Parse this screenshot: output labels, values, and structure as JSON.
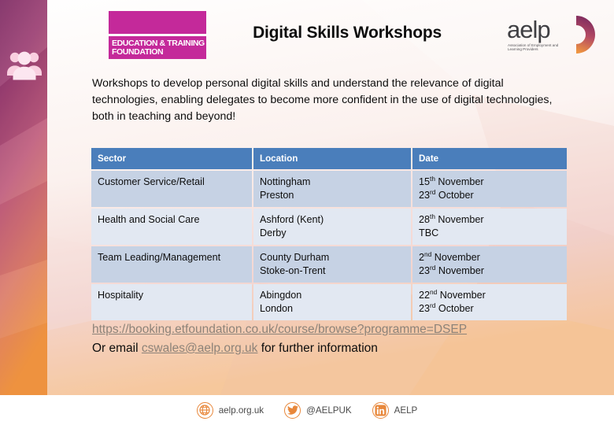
{
  "slide": {
    "title": "Digital Skills Workshops",
    "intro": "Workshops to develop personal digital skills and understand the relevance of digital technologies, enabling delegates to become more confident in the use of digital technologies, both in teaching and beyond!"
  },
  "etf_logo": {
    "line1": "EDUCATION & TRAINING",
    "line2": "FOUNDATION",
    "color": "#c4299a"
  },
  "aelp_logo": {
    "wordmark": "aelp",
    "subtitle": "Association of Employment and Learning Providers"
  },
  "table": {
    "headers": [
      "Sector",
      "Location",
      "Date"
    ],
    "header_bg": "#4a7ebb",
    "row_bg_a": "#c6d2e4",
    "row_bg_b": "#e2e8f2",
    "rows": [
      {
        "sector": "Customer Service/Retail",
        "locations": [
          "Nottingham",
          "Preston"
        ],
        "dates": [
          {
            "num": "15",
            "ord": "th",
            "rest": " November"
          },
          {
            "num": "23",
            "ord": "rd",
            "rest": " October"
          }
        ]
      },
      {
        "sector": "Health and Social Care",
        "locations": [
          "Ashford (Kent)",
          "Derby"
        ],
        "dates": [
          {
            "num": "28",
            "ord": "th",
            "rest": " November"
          },
          {
            "num": "TBC",
            "ord": "",
            "rest": ""
          }
        ]
      },
      {
        "sector": "Team Leading/Management",
        "locations": [
          "County Durham",
          "Stoke-on-Trent"
        ],
        "dates": [
          {
            "num": "2",
            "ord": "nd",
            "rest": " November"
          },
          {
            "num": "23",
            "ord": "rd",
            "rest": " November"
          }
        ]
      },
      {
        "sector": "Hospitality",
        "locations": [
          "Abingdon",
          "London"
        ],
        "dates": [
          {
            "num": "22",
            "ord": "nd",
            "rest": " November"
          },
          {
            "num": "23",
            "ord": "rd",
            "rest": " October"
          }
        ]
      }
    ]
  },
  "links": {
    "booking_url": "https://booking.etfoundation.co.uk/course/browse?programme=DSEP",
    "email_prefix": "Or email ",
    "email": "cswales@aelp.org.uk",
    "email_suffix": " for further information",
    "link_color": "#8d8379"
  },
  "footer": {
    "items": [
      {
        "icon": "globe-icon",
        "label": "aelp.org.uk"
      },
      {
        "icon": "twitter-icon",
        "label": "@AELPUK"
      },
      {
        "icon": "linkedin-icon",
        "label": "AELP"
      }
    ],
    "accent": "#e8873a"
  },
  "sidebar": {
    "icon": "people-group-icon",
    "gradient_top": "#7e2a63",
    "gradient_mid": "#c9607f",
    "gradient_bottom": "#ef9540"
  }
}
